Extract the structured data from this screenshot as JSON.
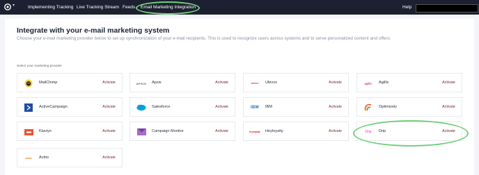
{
  "nav": {
    "items": [
      "Implementing Tracking",
      "Live Tracking Stream",
      "Feeds",
      "Email Marketing Integration"
    ],
    "help": "Help"
  },
  "header": {
    "title": "Integrate with your e-mail marketing system",
    "subtitle": "Choose your e-mail marketing provider below to set up synchronization of your e-mail recipients. This is used to recognize users across systems and to serve personalized content and offers."
  },
  "providers_label": "Select your marketing provider",
  "providers": [
    {
      "name": "MailChimp",
      "action": "Activate",
      "logo_text": "",
      "icon": "mailchimp-icon"
    },
    {
      "name": "Apsis",
      "action": "Activate",
      "logo_text": "APSIS",
      "icon": "apsis-icon"
    },
    {
      "name": "Ubivox",
      "action": "Activate",
      "logo_text": "ubivox",
      "icon": "ubivox-icon"
    },
    {
      "name": "Agillic",
      "action": "Activate",
      "logo_text": "agillic",
      "icon": "agillic-icon"
    },
    {
      "name": "ActiveCampaign",
      "action": "Activate",
      "logo_text": "",
      "icon": "activecampaign-icon"
    },
    {
      "name": "Salesforce",
      "action": "Activate",
      "logo_text": "",
      "icon": "salesforce-icon"
    },
    {
      "name": "IBM",
      "action": "Activate",
      "logo_text": "IBM",
      "icon": "ibm-icon"
    },
    {
      "name": "Optimizely",
      "action": "Activate",
      "logo_text": "",
      "icon": "optimizely-icon"
    },
    {
      "name": "Klaviyo",
      "action": "Activate",
      "logo_text": "",
      "icon": "klaviyo-icon"
    },
    {
      "name": "Campaign Monitor",
      "action": "Activate",
      "logo_text": "",
      "icon": "campaign-monitor-icon"
    },
    {
      "name": "Heyloyalty",
      "action": "Activate",
      "logo_text": "heyloyalty",
      "icon": "heyloyalty-icon"
    },
    {
      "name": "Drip",
      "action": "Activate",
      "logo_text": "Drip",
      "icon": "drip-icon"
    },
    {
      "name": "Actito",
      "action": "Activate",
      "logo_text": "actito",
      "icon": "actito-icon"
    }
  ],
  "colors": {
    "topbar": "#1c2030",
    "activate": "#7a1b2d",
    "highlight": "#6fd07a"
  }
}
